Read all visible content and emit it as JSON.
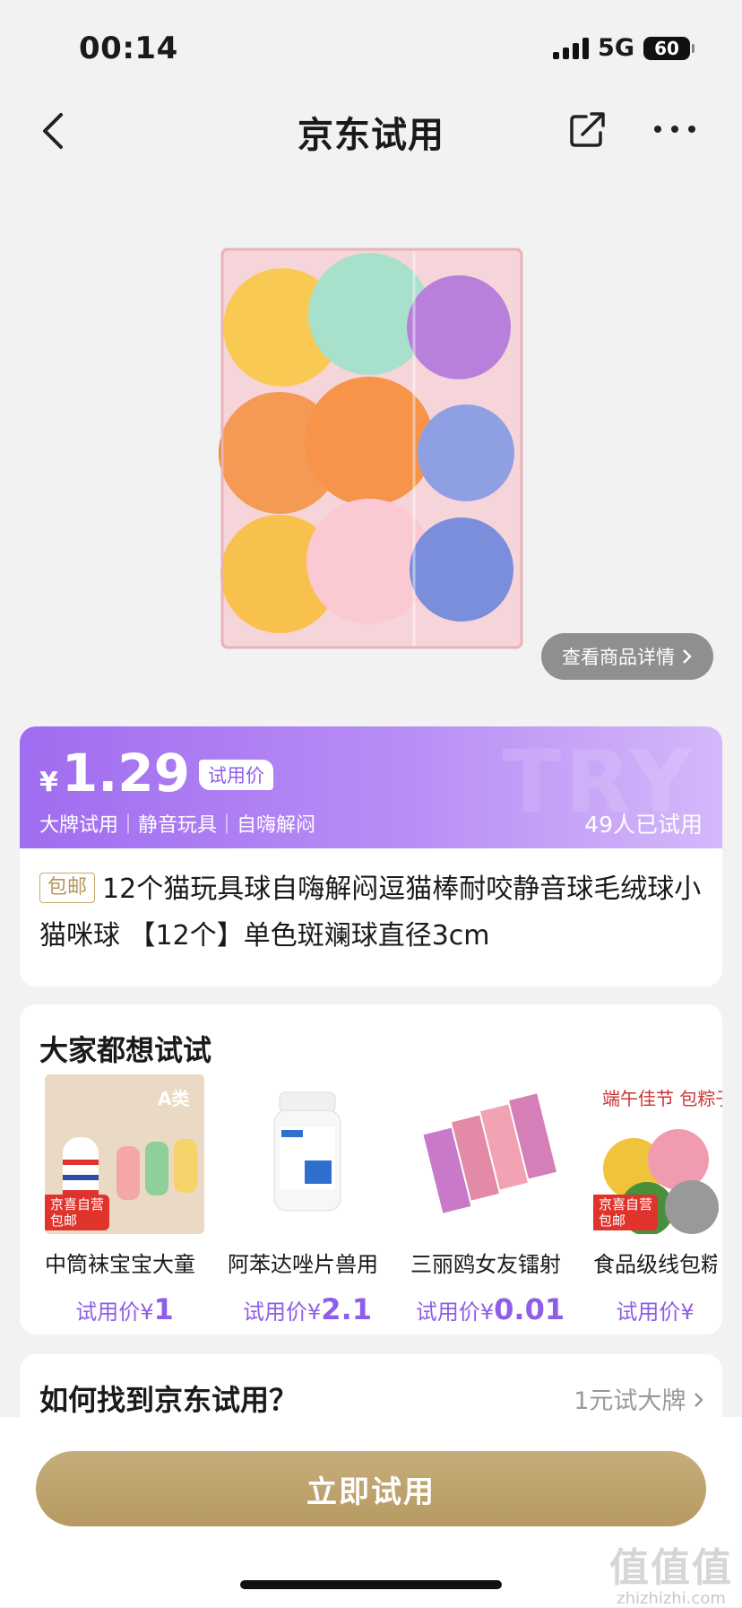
{
  "status_bar": {
    "time": "00:14",
    "network": "5G",
    "battery": "60"
  },
  "header": {
    "title": "京东试用"
  },
  "product": {
    "detail_button": "查看商品详情",
    "price_symbol": "¥",
    "price": "1.29",
    "price_tag": "试用价",
    "watermark": "TRY",
    "tags": "大牌试用｜静音玩具｜自嗨解闷",
    "tried_count": "49人已试用",
    "free_shipping": "包邮",
    "title": "12个猫玩具球自嗨解闷逗猫棒耐咬静音球毛绒球小猫咪球 【12个】单色斑斓球直径3cm"
  },
  "recommend": {
    "title": "大家都想试试",
    "items": [
      {
        "name": "中筒袜宝宝大童",
        "price_label": "试用价¥",
        "price": "1",
        "badge_line1": "京喜自营",
        "badge_line2": "包邮",
        "thumb_text": "A类"
      },
      {
        "name": "阿苯达唑片兽用",
        "price_label": "试用价¥",
        "price": "2.1"
      },
      {
        "name": "三丽鸥女友镭射",
        "price_label": "试用价¥",
        "price": "0.01"
      },
      {
        "name": "食品级线包粽子",
        "price_label": "试用价¥",
        "price": "",
        "badge_line1": "京喜自营",
        "badge_line2": "包邮",
        "thumb_text": "端午佳节 包粽子"
      }
    ]
  },
  "howto": {
    "title": "如何找到京东试用？",
    "link": "1元试大牌"
  },
  "cta": {
    "label": "立即试用"
  },
  "watermark_site": {
    "logo": "值值值",
    "url": "zhizhizhi.com"
  }
}
